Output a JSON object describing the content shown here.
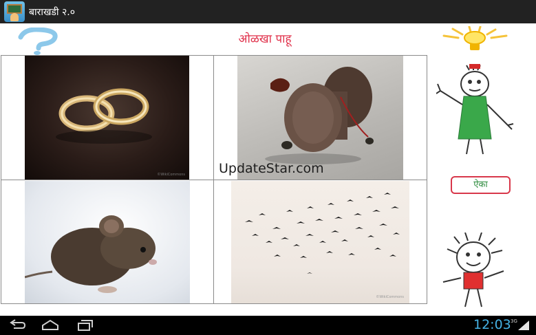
{
  "app": {
    "title": "बाराखडी २.०"
  },
  "header": {
    "heading": "ओळखा पाहू"
  },
  "quiz": {
    "images": [
      {
        "name": "rings",
        "caption": "©WikiCommons"
      },
      {
        "name": "damru",
        "caption": ""
      },
      {
        "name": "mouse",
        "caption": ""
      },
      {
        "name": "birds",
        "caption": "©WikiCommons"
      }
    ],
    "watermark": "UpdateStar.com"
  },
  "sidebar": {
    "listen_label": "ऐका"
  },
  "statusbar": {
    "time": "12:03",
    "network": "3G"
  },
  "colors": {
    "actionbar": "#222222",
    "heading": "#e0304a",
    "button_border": "#d8374a",
    "clock": "#46b3e6"
  },
  "icons": [
    "app-icon",
    "question-mark-icon",
    "lightbulb-icon",
    "back-icon",
    "home-icon",
    "recent-apps-icon",
    "signal-icon"
  ]
}
